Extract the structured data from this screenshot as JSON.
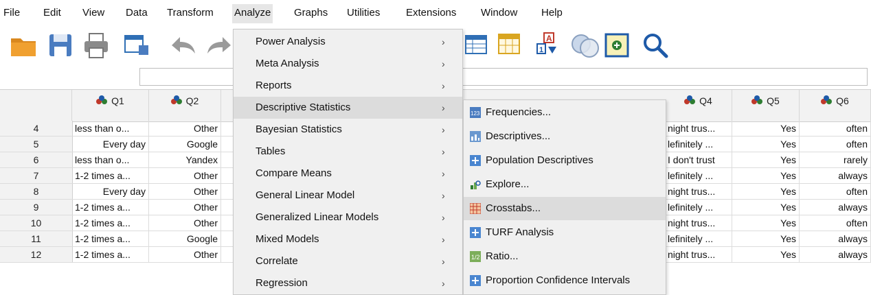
{
  "menubar": {
    "items": [
      {
        "label": "File",
        "u": "F"
      },
      {
        "label": "Edit",
        "u": "E"
      },
      {
        "label": "View",
        "u": "V"
      },
      {
        "label": "Data",
        "u": "D"
      },
      {
        "label": "Transform",
        "u": "T"
      },
      {
        "label": "Analyze",
        "u": "A"
      },
      {
        "label": "Graphs",
        "u": "G"
      },
      {
        "label": "Utilities",
        "u": "U"
      },
      {
        "label": "Extensions",
        "u": "x"
      },
      {
        "label": "Window",
        "u": "W"
      },
      {
        "label": "Help",
        "u": "H"
      }
    ]
  },
  "toolbar": {
    "icons": [
      "open-folder-icon",
      "save-icon",
      "print-icon",
      "dialog-recall-icon",
      "undo-icon",
      "redo-icon",
      "goto-case-icon",
      "variables-icon",
      "value-labels-icon",
      "use-sets-icon",
      "insert-case-icon",
      "search-icon"
    ]
  },
  "grid": {
    "columns": [
      {
        "name": "Q1"
      },
      {
        "name": "Q2"
      },
      {
        "name": "Q4"
      },
      {
        "name": "Q5"
      },
      {
        "name": "Q6"
      }
    ],
    "rows": [
      {
        "num": "4",
        "q1": "less than o...",
        "q2": "Other",
        "q4": "night trus...",
        "q5": "Yes",
        "q6": "often"
      },
      {
        "num": "5",
        "q1": "Every day",
        "q2": "Google",
        "q4": "lefinitely ...",
        "q5": "Yes",
        "q6": "often"
      },
      {
        "num": "6",
        "q1": "less than o...",
        "q2": "Yandex",
        "q4": "I don't trust",
        "q5": "Yes",
        "q6": "rarely"
      },
      {
        "num": "7",
        "q1": "1-2 times a...",
        "q2": "Other",
        "q4": "lefinitely ...",
        "q5": "Yes",
        "q6": "always"
      },
      {
        "num": "8",
        "q1": "Every day",
        "q2": "Other",
        "q4": "night trus...",
        "q5": "Yes",
        "q6": "often"
      },
      {
        "num": "9",
        "q1": "1-2 times a...",
        "q2": "Other",
        "q4": "lefinitely ...",
        "q5": "Yes",
        "q6": "always"
      },
      {
        "num": "10",
        "q1": "1-2 times a...",
        "q2": "Other",
        "q4": "night trus...",
        "q5": "Yes",
        "q6": "often"
      },
      {
        "num": "11",
        "q1": "1-2 times a...",
        "q2": "Google",
        "q4": "lefinitely ...",
        "q5": "Yes",
        "q6": "always"
      },
      {
        "num": "12",
        "q1": "1-2 times a...",
        "q2": "Other",
        "q4": "night trus...",
        "q5": "Yes",
        "q6": "always"
      }
    ]
  },
  "analyze_menu": {
    "items": [
      {
        "label": "Power Analysis",
        "u": "w",
        "arrow": "›"
      },
      {
        "label": "Meta Analysis",
        "u": "",
        "arrow": "›"
      },
      {
        "label": "Reports",
        "u": "p",
        "arrow": "›"
      },
      {
        "label": "Descriptive Statistics",
        "u": "E",
        "arrow": "›"
      },
      {
        "label": "Bayesian Statistics",
        "u": "y",
        "arrow": "›"
      },
      {
        "label": "Tables",
        "u": "b",
        "arrow": "›"
      },
      {
        "label": "Compare Means",
        "u": "m",
        "arrow": "›"
      },
      {
        "label": "General Linear Model",
        "u": "G",
        "arrow": "›"
      },
      {
        "label": "Generalized Linear Models",
        "u": "z",
        "arrow": "›"
      },
      {
        "label": "Mixed Models",
        "u": "x",
        "arrow": "›"
      },
      {
        "label": "Correlate",
        "u": "C",
        "arrow": "›"
      },
      {
        "label": "Regression",
        "u": "R",
        "arrow": "›"
      }
    ],
    "selected_index": 3
  },
  "descriptive_submenu": {
    "items": [
      {
        "label": "Frequencies...",
        "u": "F",
        "icon": "frequencies-icon"
      },
      {
        "label": "Descriptives...",
        "u": "D",
        "icon": "descriptives-icon"
      },
      {
        "label": "Population Descriptives",
        "u": "",
        "icon": "population-descriptives-icon"
      },
      {
        "label": "Explore...",
        "u": "E",
        "icon": "explore-icon"
      },
      {
        "label": "Crosstabs...",
        "u": "C",
        "icon": "crosstabs-icon"
      },
      {
        "label": "TURF Analysis",
        "u": "",
        "icon": "turf-analysis-icon"
      },
      {
        "label": "Ratio...",
        "u": "R",
        "icon": "ratio-icon"
      },
      {
        "label": "Proportion Confidence Intervals",
        "u": "",
        "icon": "proportion-ci-icon"
      }
    ],
    "selected_index": 4
  },
  "colors": {
    "menu_bg": "#f0f0f0",
    "menu_selected": "#dcdcdc",
    "header_bg": "#f2f2f2",
    "accent_blue": "#1e5aa8",
    "folder_orange": "#f0a030"
  }
}
